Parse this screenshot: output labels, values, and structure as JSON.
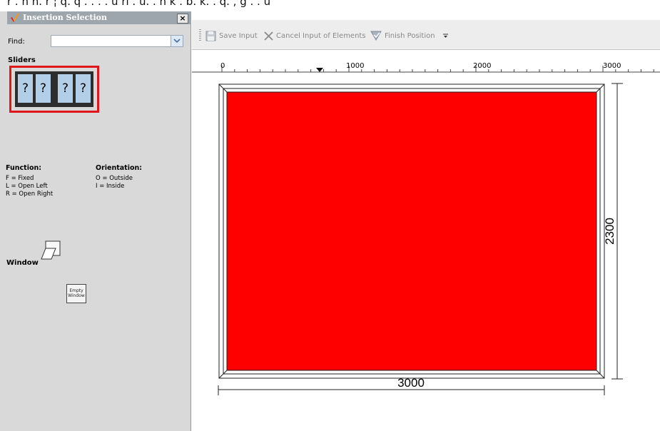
{
  "top_strip_text": "r . n  h. r  ¦ q. q .  . . . u   rl . u. .   n  k . b.   k. .   q.  , g  .   . u",
  "panel": {
    "title": "Insertion Selection",
    "close": "×",
    "find_label": "Find:",
    "find_value": "",
    "sliders_heading": "Sliders",
    "slider_panes": [
      "?",
      "?",
      "?",
      "?"
    ],
    "function_heading": "Function:",
    "function_lines": [
      "F = Fixed",
      "L = Open Left",
      "R = Open Right"
    ],
    "orientation_heading": "Orientation:",
    "orientation_lines": [
      "O = Outside",
      "I = Inside"
    ],
    "window_heading": "Window",
    "empty_window_label": "Empty Window"
  },
  "toolbar": {
    "save_label": "Save Input",
    "cancel_label": "Cancel Input of Elements",
    "finish_label": "Finish Position"
  },
  "canvas": {
    "ruler_labels": [
      "0",
      "1000",
      "2000",
      "3000"
    ],
    "width_dimension": "3000",
    "height_dimension": "2300",
    "fill_color": "#ff0000"
  }
}
